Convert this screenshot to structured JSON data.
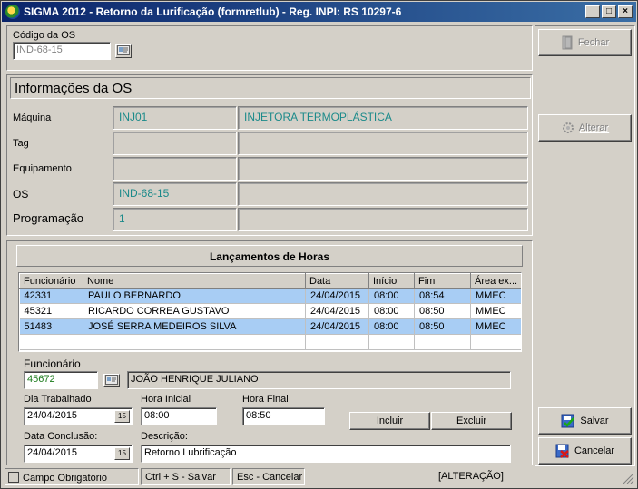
{
  "window": {
    "title": "SIGMA 2012 - Retorno da Lurificação  (formretlub)  - Reg. INPI: RS 10297-6",
    "min": "_",
    "max": "□",
    "close": "×"
  },
  "os_code": {
    "label": "Código da OS",
    "value": "IND-68-15"
  },
  "info": {
    "title": "Informações da OS",
    "rows": [
      {
        "label": "Máquina",
        "code": "INJ01",
        "desc": "INJETORA TERMOPLÁSTICA"
      },
      {
        "label": "Tag",
        "code": "",
        "desc": ""
      },
      {
        "label": "Equipamento",
        "code": "",
        "desc": ""
      },
      {
        "label": "OS",
        "code": "IND-68-15",
        "desc": ""
      },
      {
        "label": "Programação",
        "code": "1",
        "desc": ""
      }
    ]
  },
  "hours": {
    "title": "Lançamentos de Horas",
    "columns": [
      "Funcionário",
      "Nome",
      "Data",
      "Início",
      "Fim",
      "Área ex..."
    ],
    "rows": [
      {
        "func": "42331",
        "nome": "PAULO BERNARDO",
        "data": "24/04/2015",
        "inicio": "08:00",
        "fim": "08:54",
        "area": "MMEC",
        "selected": true
      },
      {
        "func": "45321",
        "nome": "RICARDO CORREA GUSTAVO",
        "data": "24/04/2015",
        "inicio": "08:00",
        "fim": "08:50",
        "area": "MMEC",
        "selected": false
      },
      {
        "func": "51483",
        "nome": "JOSÉ SERRA MEDEIROS SILVA",
        "data": "24/04/2015",
        "inicio": "08:00",
        "fim": "08:50",
        "area": "MMEC",
        "selected": true
      }
    ]
  },
  "form": {
    "funcionario_label": "Funcionário",
    "funcionario_value": "45672",
    "funcionario_name": "JOÃO HENRIQUE JULIANO",
    "dia_label": "Dia Trabalhado",
    "dia_value": "24/04/2015",
    "hora_inicial_label": "Hora Inicial",
    "hora_inicial_value": "08:00",
    "hora_final_label": "Hora Final",
    "hora_final_value": "08:50",
    "incluir": "Incluir",
    "excluir": "Excluir",
    "data_conclusao_label": "Data Conclusão:",
    "data_conclusao_value": "24/04/2015",
    "descricao_label": "Descrição:",
    "descricao_value": "Retorno Lubrificação",
    "calendar_glyph": "15"
  },
  "side": {
    "fechar": "Fechar",
    "alterar": "Alterar",
    "salvar": "Salvar",
    "cancelar": "Cancelar"
  },
  "status": {
    "obrigatorio": "Campo Obrigatório",
    "salvar_hint": "Ctrl + S - Salvar",
    "cancelar_hint": "Esc - Cancelar",
    "mode": "[ALTERAÇÃO]"
  }
}
